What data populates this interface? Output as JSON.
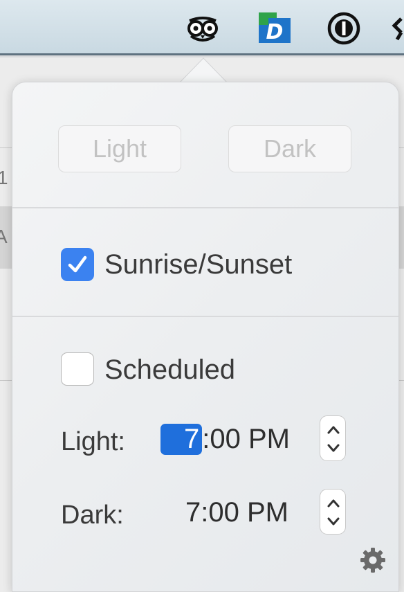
{
  "menubar": {
    "icons": [
      "owl-icon",
      "dash-app-icon",
      "one-password-icon",
      "menubar-edge-icon"
    ],
    "dash_letter": "D"
  },
  "background_window": {
    "fragments": [
      "1",
      "A"
    ]
  },
  "popover": {
    "buttons": {
      "light_label": "Light",
      "dark_label": "Dark"
    },
    "sunrise_sunset": {
      "label": "Sunrise/Sunset",
      "checked": true
    },
    "scheduled": {
      "label": "Scheduled",
      "checked": false
    },
    "times": {
      "light_label": "Light:",
      "light_hour": "7",
      "light_rest": ":00 PM",
      "dark_label": "Dark:",
      "dark_time": "7:00 PM"
    },
    "settings_icon": "gear-icon"
  },
  "colors": {
    "accent": "#3b82f0",
    "selection": "#1f6fdc"
  }
}
